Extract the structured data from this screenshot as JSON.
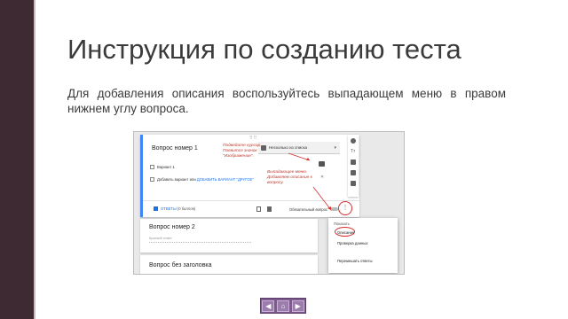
{
  "slide": {
    "title": "Инструкция по созданию теста",
    "body": "Для добавления описания воспользуйтесь выпадающем меню в правом нижнем углу вопроса."
  },
  "screenshot": {
    "question1": {
      "title": "Вопрос номер 1",
      "type_label": "Несколько из списка",
      "option1": "Вариант 1",
      "add_option_prefix": "Добавить вариант или",
      "add_other_link": "ДОБАВИТЬ ВАРИАНТ \"ДРУГОЕ\"",
      "answers_label": "ОТВЕТЫ",
      "points": "(0 баллов)",
      "required_label": "Обязательный вопрос",
      "more_glyph": "⋮"
    },
    "callout1": "Подведите курсор. Появится значок \"Изображение\".",
    "callout2": "Выпадающее меню. Добавляем описание к вопросу.",
    "question2": {
      "title": "Вопрос номер 2",
      "hint": "Краткий ответ"
    },
    "question3": {
      "title": "Вопрос без заголовка"
    },
    "menu": {
      "header": "Показать",
      "items": [
        "Описание",
        "Проверка данных",
        "Перемешать ответы"
      ]
    }
  },
  "navigation": {
    "buttons": [
      "◀",
      "⌂",
      "▶"
    ]
  },
  "icons": {
    "add": "plus-circle-icon",
    "title": "text-title-icon",
    "image": "image-icon",
    "video": "video-icon",
    "section": "section-icon"
  },
  "colors": {
    "accent_blue": "#4285f4",
    "annotation_red": "#d32f2f",
    "nav_purple": "#7d5a8e",
    "sidebar": "#3e2a33"
  }
}
